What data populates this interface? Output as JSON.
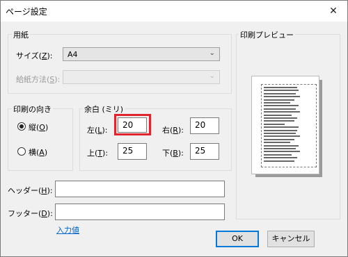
{
  "window": {
    "title": "ページ設定",
    "close_glyph": "✕"
  },
  "paper": {
    "group_label": "用紙",
    "size_label_pre": "サイズ(",
    "size_label_key": "Z",
    "size_label_post": "):",
    "size_value": "A4",
    "source_label_pre": "給紙方法(",
    "source_label_key": "S",
    "source_label_post": "):",
    "source_value": ""
  },
  "orientation": {
    "group_label": "印刷の向き",
    "portrait_pre": "縦(",
    "portrait_key": "O",
    "portrait_post": ")",
    "landscape_pre": "横(",
    "landscape_key": "A",
    "landscape_post": ")",
    "selected": "portrait"
  },
  "margins": {
    "group_label": "余白 (ミリ)",
    "left_pre": "左(",
    "left_key": "L",
    "left_post": "):",
    "left_value": "20",
    "right_pre": "右(",
    "right_key": "R",
    "right_post": "):",
    "right_value": "20",
    "top_pre": "上(",
    "top_key": "T",
    "top_post": "):",
    "top_value": "25",
    "bottom_pre": "下(",
    "bottom_key": "B",
    "bottom_post": "):",
    "bottom_value": "25"
  },
  "header": {
    "label_pre": "ヘッダー(",
    "label_key": "H",
    "label_post": "):",
    "value": ""
  },
  "footer": {
    "label_pre": "フッター(",
    "label_key": "D",
    "label_post": "):",
    "value": ""
  },
  "input_values_link": "入力値",
  "preview": {
    "group_label": "印刷プレビュー"
  },
  "buttons": {
    "ok": "OK",
    "cancel": "キャンセル"
  },
  "icons": {
    "chevron": "chevron-down-icon",
    "close": "close-icon"
  }
}
